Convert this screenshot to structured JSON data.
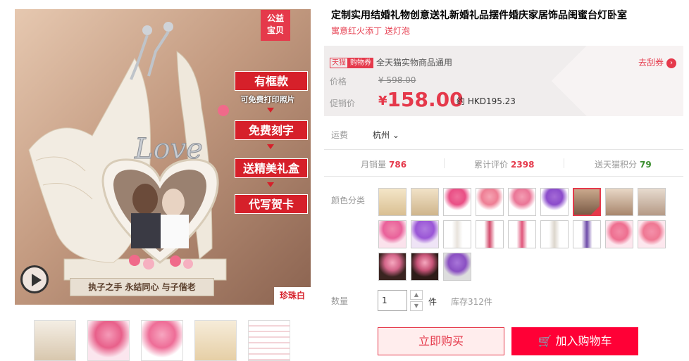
{
  "gallery": {
    "badge_line1": "公益",
    "badge_line2": "宝贝",
    "promo_items": [
      "有框款",
      "免费刻字",
      "送精美礼盒",
      "代写贺卡"
    ],
    "promo_sub": "可免费打印照片",
    "plaque_text": "执子之手 永结同心 与子偕老",
    "color_label": "珍珠白",
    "love_text": "Love"
  },
  "product": {
    "title": "定制实用结婚礼物创意送礼新婚礼品摆件婚庆家居饰品闺蜜台灯卧室",
    "subtitle": "寓意红火添丁 送灯泡"
  },
  "price_box": {
    "tag1": "天猫",
    "tag2": "购物券",
    "coupon_text": "全天猫实物商品通用",
    "get_coupon": "去刮券",
    "get_coupon_arrow": "›",
    "price_label": "价格",
    "original_price": "¥ 598.00",
    "promo_label": "促销价",
    "currency": "¥",
    "promo_price": "158.00",
    "hkd": "约 HKD195.23"
  },
  "shipping": {
    "label": "运费",
    "value": "杭州"
  },
  "stats": {
    "monthly_sales_label": "月销量",
    "monthly_sales": "786",
    "reviews_label": "累计评价",
    "reviews": "2398",
    "points_label": "送天猫积分",
    "points": "79"
  },
  "color": {
    "label": "颜色分类"
  },
  "quantity": {
    "label": "数量",
    "value": "1",
    "unit": "件",
    "stock": "库存312件"
  },
  "actions": {
    "buy_now": "立即购买",
    "add_to_cart": "加入购物车"
  },
  "colors": {
    "accent": "#e5394b",
    "cart": "#ff0036"
  }
}
